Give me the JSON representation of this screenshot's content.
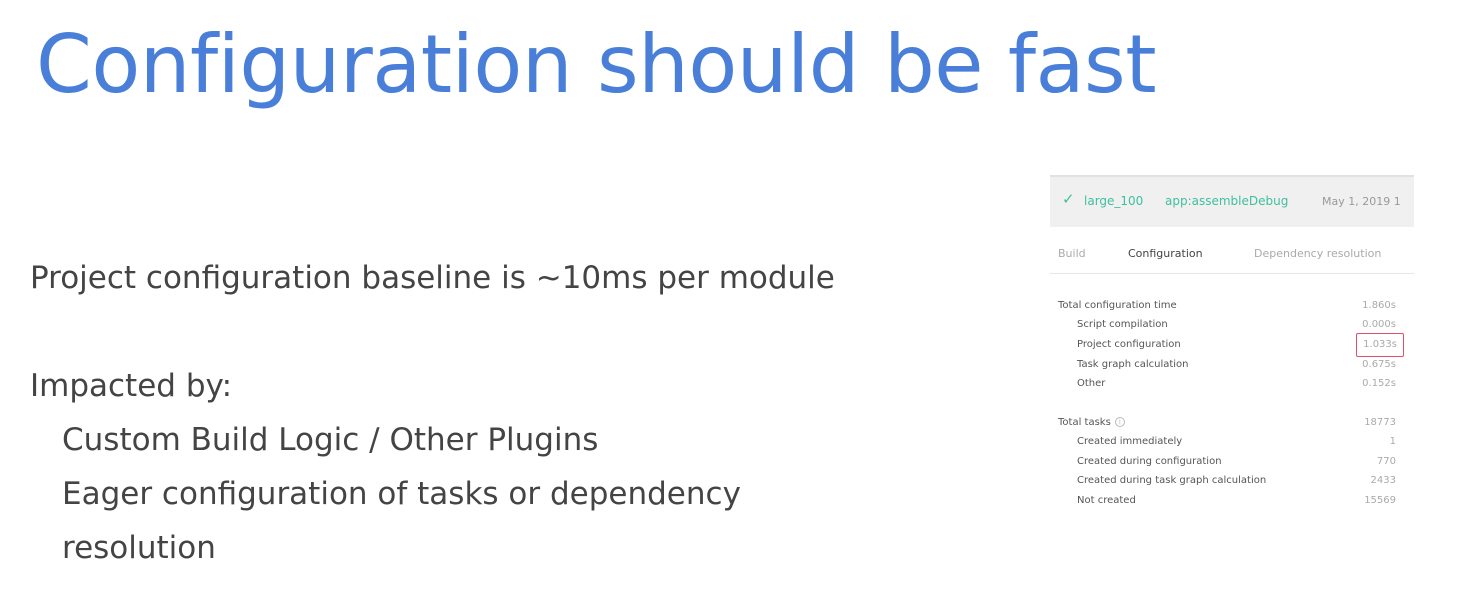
{
  "slide": {
    "title": "Configuration should be fast",
    "baseline": "Project configuration baseline is ~10ms per module",
    "impacted_heading": "Impacted by:",
    "impacted_items": [
      "Custom Build Logic / Other Plugins",
      "Eager configuration of tasks or dependency",
      "resolution"
    ]
  },
  "scan": {
    "header": {
      "status_icon": "check-icon",
      "project": "large_100",
      "task": "app:assembleDebug",
      "date": "May 1, 2019 1"
    },
    "tabs": [
      "Build",
      "Configuration",
      "Dependency resolution"
    ],
    "active_tab": "Configuration",
    "configuration": [
      {
        "label": "Total configuration time",
        "value": "1.860s"
      },
      {
        "label": "Script compilation",
        "value": "0.000s"
      },
      {
        "label": "Project configuration",
        "value": "1.033s"
      },
      {
        "label": "Task graph calculation",
        "value": "0.675s"
      },
      {
        "label": "Other",
        "value": "0.152s"
      }
    ],
    "tasks": [
      {
        "label": "Total tasks",
        "value": "18773"
      },
      {
        "label": "Created immediately",
        "value": "1"
      },
      {
        "label": "Created during configuration",
        "value": "770"
      },
      {
        "label": "Created during task graph calculation",
        "value": "2433"
      },
      {
        "label": "Not created",
        "value": "15569"
      }
    ],
    "highlight_color": "#e0506a",
    "accent_color": "#3fbf9f"
  },
  "colors": {
    "title": "#4a7fd9",
    "body_text": "#444444"
  }
}
